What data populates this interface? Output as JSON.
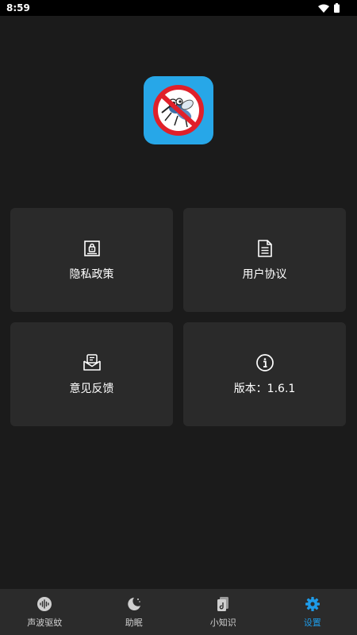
{
  "status_bar": {
    "time": "8:59",
    "wifi_icon": "wifi-icon",
    "battery_icon": "battery-icon"
  },
  "app": {
    "icon": "no-mosquito-logo"
  },
  "cards": [
    {
      "label": "隐私政策",
      "icon": "privacy-lock-document-icon"
    },
    {
      "label": "用户协议",
      "icon": "document-text-icon"
    },
    {
      "label": "意见反馈",
      "icon": "feedback-mail-icon"
    },
    {
      "label": "版本：1.6.1",
      "icon": "info-circle-icon"
    }
  ],
  "nav": {
    "items": [
      {
        "label": "声波驱蚊",
        "icon": "sound-wave-icon"
      },
      {
        "label": "助眠",
        "icon": "moon-stars-icon"
      },
      {
        "label": "小知识",
        "icon": "knowledge-book-icon"
      },
      {
        "label": "设置",
        "icon": "gear-icon"
      }
    ],
    "active_index": 3,
    "active_color": "#1e9be8"
  },
  "colors": {
    "background": "#1b1b1b",
    "card": "#2a2a2a",
    "nav": "#2b2b2b",
    "app_icon_bg": "#27a7e8"
  }
}
